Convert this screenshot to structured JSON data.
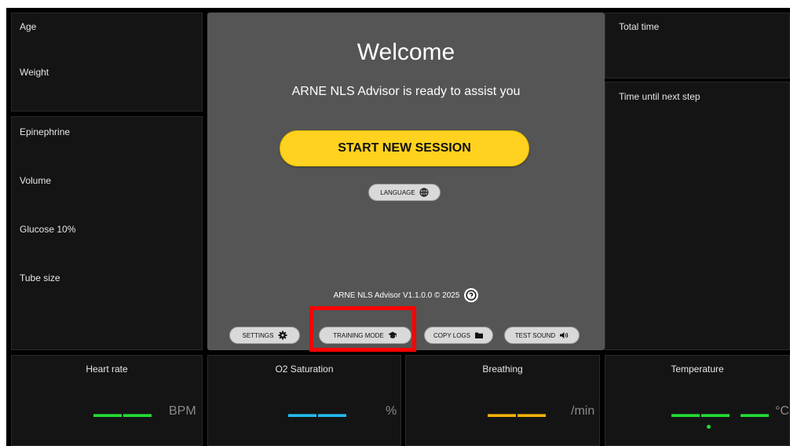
{
  "patient": {
    "age_label": "Age",
    "weight_label": "Weight"
  },
  "meds": {
    "epinephrine_label": "Epinephrine",
    "volume_label": "Volume",
    "glucose_label": "Glucose 10%",
    "tube_label": "Tube size"
  },
  "timers": {
    "total_label": "Total time",
    "next_label": "Time until next step"
  },
  "welcome": {
    "title": "Welcome",
    "subtitle": "ARNE NLS Advisor is ready to assist you",
    "start_label": "START NEW SESSION",
    "language_label": "LANGUAGE",
    "version": "ARNE NLS Advisor V1.1.0.0 © 2025"
  },
  "toolbar": {
    "settings_label": "SETTINGS",
    "training_label": "TRAINING MODE",
    "copylogs_label": "COPY LOGS",
    "testsound_label": "TEST SOUND"
  },
  "vitals": {
    "heart": {
      "title": "Heart rate",
      "value": "——",
      "unit": "BPM",
      "color": "#22dd33"
    },
    "o2": {
      "title": "O2 Saturation",
      "value": "——",
      "unit": "%",
      "color": "#22bbee"
    },
    "breath": {
      "title": "Breathing",
      "value": "——",
      "unit": "/min",
      "color": "#f2b20a"
    },
    "temp": {
      "title": "Temperature",
      "value": "—— —",
      "unit": "°C",
      "color": "#22dd33"
    }
  },
  "icons": {
    "settings": "gear-icon",
    "training": "graduation-cap-icon",
    "copylogs": "folder-icon",
    "testsound": "speaker-icon",
    "language": "globe-icon",
    "help": "question-icon"
  }
}
